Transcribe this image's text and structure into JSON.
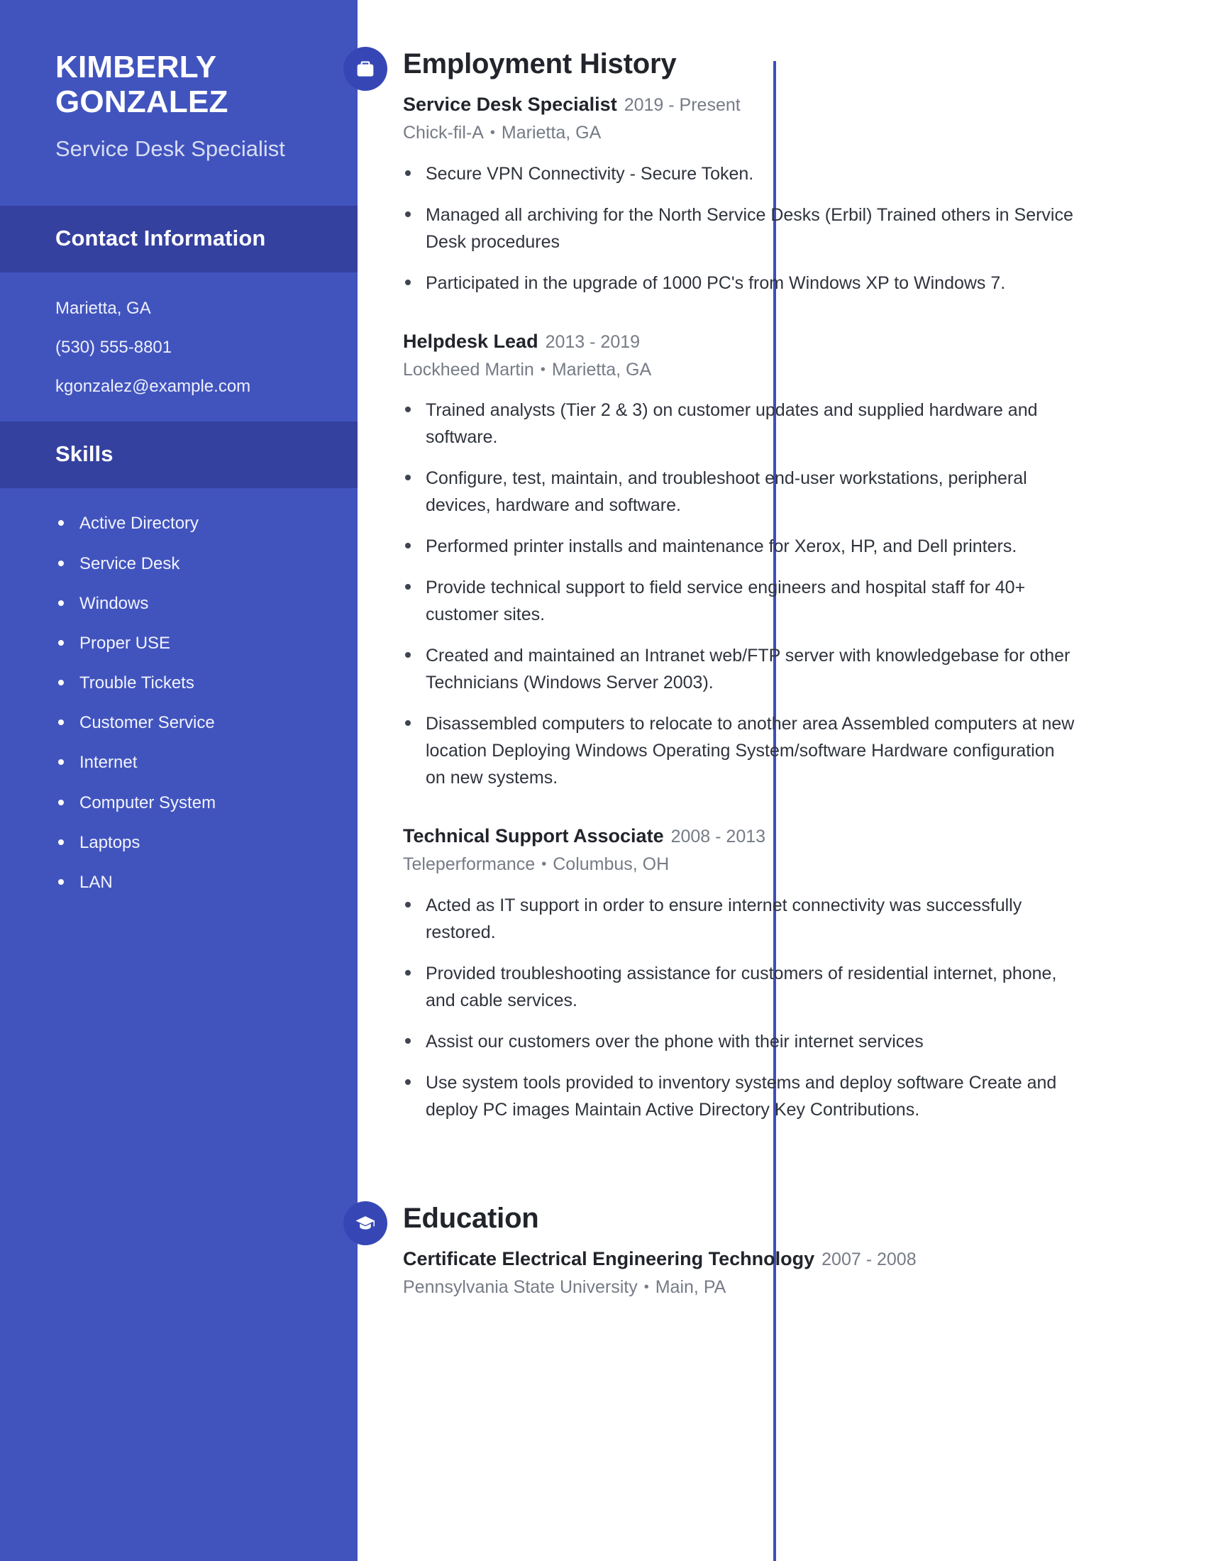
{
  "theme": {
    "sidebar_bg": "#4154be",
    "sidebar_head_bg": "#35419f",
    "accent": "#3647b5",
    "timeline": "#3d4fbb",
    "text_dark": "#21242b",
    "text_muted": "#767b86"
  },
  "sidebar": {
    "name": "KIMBERLY GONZALEZ",
    "job_title": "Service Desk Specialist",
    "contact_heading": "Contact Information",
    "contact": [
      "Marietta, GA",
      "(530) 555-8801",
      "kgonzalez@example.com"
    ],
    "skills_heading": "Skills",
    "skills": [
      "Active Directory",
      "Service Desk",
      "Windows",
      "Proper USE",
      "Trouble Tickets",
      "Customer Service",
      "Internet",
      "Computer System",
      "Laptops",
      "LAN"
    ]
  },
  "employment": {
    "heading": "Employment History",
    "icon": "briefcase-icon",
    "jobs": [
      {
        "role": "Service Desk Specialist",
        "dates": "2019 - Present",
        "company": "Chick-fil-A",
        "location": "Marietta, GA",
        "bullets": [
          "Secure VPN Connectivity - Secure Token.",
          "Managed all archiving for the North Service Desks (Erbil) Trained others in Service Desk procedures",
          "Participated in the upgrade of 1000 PC's from Windows XP to Windows 7."
        ]
      },
      {
        "role": "Helpdesk Lead",
        "dates": "2013 - 2019",
        "company": "Lockheed Martin",
        "location": "Marietta, GA",
        "bullets": [
          "Trained analysts (Tier 2 & 3) on customer updates and supplied hardware and software.",
          "Configure, test, maintain, and troubleshoot end-user workstations, peripheral devices, hardware and software.",
          "Performed printer installs and maintenance for Xerox, HP, and Dell printers.",
          "Provide technical support to field service engineers and hospital staff for 40+ customer sites.",
          "Created and maintained an Intranet web/FTP server with knowledgebase for other Technicians (Windows Server 2003).",
          "Disassembled computers to relocate to another area Assembled computers at new location Deploying Windows Operating System/software Hardware configuration on new systems."
        ]
      },
      {
        "role": "Technical Support Associate",
        "dates": "2008 - 2013",
        "company": "Teleperformance",
        "location": "Columbus, OH",
        "bullets": [
          "Acted as IT support in order to ensure internet connectivity was successfully restored.",
          "Provided troubleshooting assistance for customers of residential internet, phone, and cable services.",
          "Assist our customers over the phone with their internet services",
          "Use system tools provided to inventory systems and deploy software Create and deploy PC images Maintain Active Directory Key Contributions."
        ]
      }
    ]
  },
  "education": {
    "heading": "Education",
    "icon": "graduation-cap-icon",
    "entries": [
      {
        "degree": "Certificate Electrical Engineering Technology",
        "dates": "2007 - 2008",
        "school": "Pennsylvania State University",
        "location": "Main, PA"
      }
    ]
  },
  "separator": "•"
}
